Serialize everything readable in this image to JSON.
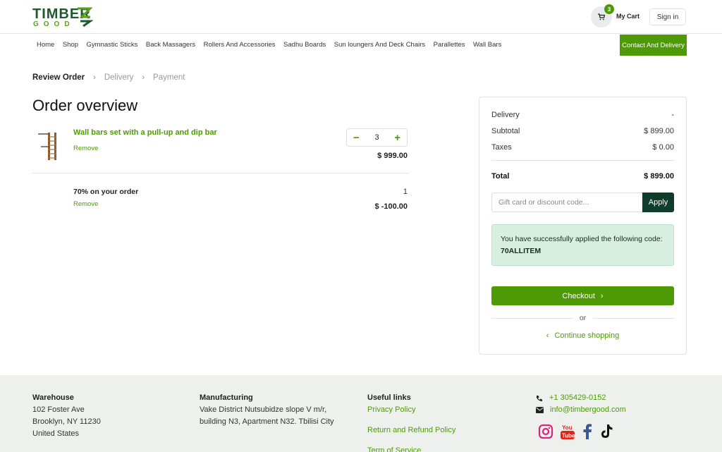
{
  "header": {
    "logo_top": "TIMBER",
    "logo_bottom": "GOOD",
    "cart_count": "3",
    "cart_label": "My Cart",
    "signin_label": "Sign in"
  },
  "nav": {
    "items": [
      "Home",
      "Shop",
      "Gymnastic Sticks",
      "Back Massagers",
      "Rollers And Accessories",
      "Sadhu Boards",
      "Sun loungers And Deck Chairs",
      "Parallettes",
      "Wall Bars"
    ],
    "contact_label": "Contact And Delivery"
  },
  "steps": {
    "review": "Review Order",
    "delivery": "Delivery",
    "payment": "Payment"
  },
  "order": {
    "title": "Order overview",
    "lines": [
      {
        "name": "Wall bars set with a pull-up and dip bar",
        "remove": "Remove",
        "qty": "3",
        "price": "$ 999.00"
      },
      {
        "name": "70% on your order",
        "remove": "Remove",
        "qty": "1",
        "price": "$ -100.00"
      }
    ]
  },
  "summary": {
    "delivery_label": "Delivery",
    "delivery_value": "-",
    "subtotal_label": "Subtotal",
    "subtotal_value": "$ 899.00",
    "taxes_label": "Taxes",
    "taxes_value": "$ 0.00",
    "total_label": "Total",
    "total_value": "$ 899.00",
    "promo_placeholder": "Gift card or discount code...",
    "apply_label": "Apply",
    "success_text": "You have successfully applied the following code:",
    "success_code": "70ALLITEM",
    "checkout_label": "Checkout",
    "or_label": "or",
    "continue_label": "Continue shopping"
  },
  "footer": {
    "warehouse": {
      "heading": "Warehouse",
      "line1": "102 Foster Ave",
      "line2": "Brooklyn, NY 11230",
      "line3": "United States"
    },
    "manufacturing": {
      "heading": "Manufacturing",
      "line1": "Vake District Nutsubidze slope V m/r,",
      "line2": "building N3, Apartment N32. Tbilisi City"
    },
    "links": {
      "heading": "Useful links",
      "privacy": "Privacy Policy",
      "refund": "Return and Refund Policy",
      "terms": "Term of Service"
    },
    "contact": {
      "phone": "+1 305429-0152",
      "email": "info@timbergood.com"
    }
  },
  "colors": {
    "accent": "#4e9a06",
    "dark_green": "#0e3d2c",
    "success_bg": "#d6efe0"
  }
}
